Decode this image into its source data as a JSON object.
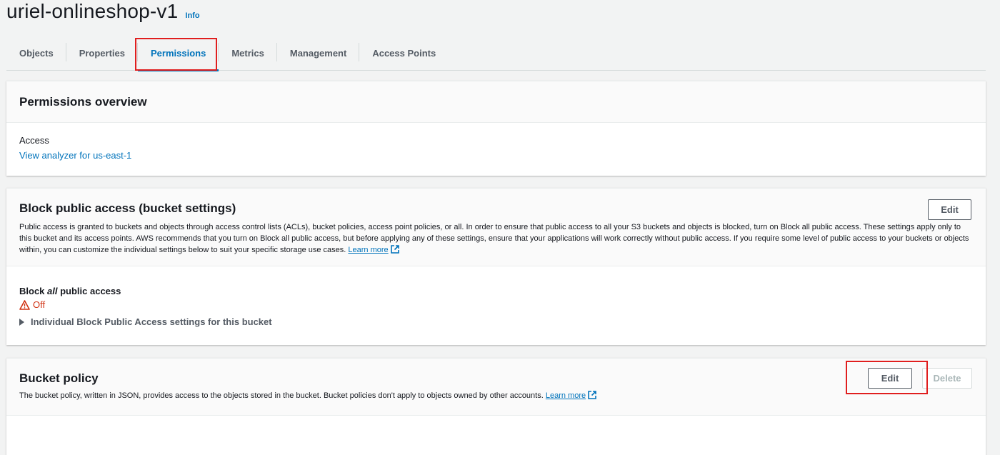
{
  "header": {
    "bucket_name": "uriel-onlineshop-v1",
    "info_link": "Info"
  },
  "tabs": [
    {
      "label": "Objects",
      "active": false
    },
    {
      "label": "Properties",
      "active": false
    },
    {
      "label": "Permissions",
      "active": true
    },
    {
      "label": "Metrics",
      "active": false
    },
    {
      "label": "Management",
      "active": false
    },
    {
      "label": "Access Points",
      "active": false
    }
  ],
  "overview": {
    "title": "Permissions overview",
    "access_label": "Access",
    "analyzer_link": "View analyzer for us-east-1"
  },
  "block_public_access": {
    "title": "Block public access (bucket settings)",
    "description": "Public access is granted to buckets and objects through access control lists (ACLs), bucket policies, access point policies, or all. In order to ensure that public access to all your S3 buckets and objects is blocked, turn on Block all public access. These settings apply only to this bucket and its access points. AWS recommends that you turn on Block all public access, but before applying any of these settings, ensure that your applications will work correctly without public access. If you require some level of public access to your buckets or objects within, you can customize the individual settings below to suit your specific storage use cases.",
    "learn_more": "Learn more",
    "edit_label": "Edit",
    "setting_label_prefix": "Block ",
    "setting_label_em": "all",
    "setting_label_suffix": " public access",
    "status": "Off",
    "expand_label": "Individual Block Public Access settings for this bucket"
  },
  "bucket_policy": {
    "title": "Bucket policy",
    "description": "The bucket policy, written in JSON, provides access to the objects stored in the bucket. Bucket policies don't apply to objects owned by other accounts.",
    "learn_more": "Learn more",
    "edit_label": "Edit",
    "delete_label": "Delete"
  },
  "colors": {
    "accent_link": "#0073bb",
    "warning_red": "#d13212",
    "highlight_box": "#e01e1e"
  }
}
